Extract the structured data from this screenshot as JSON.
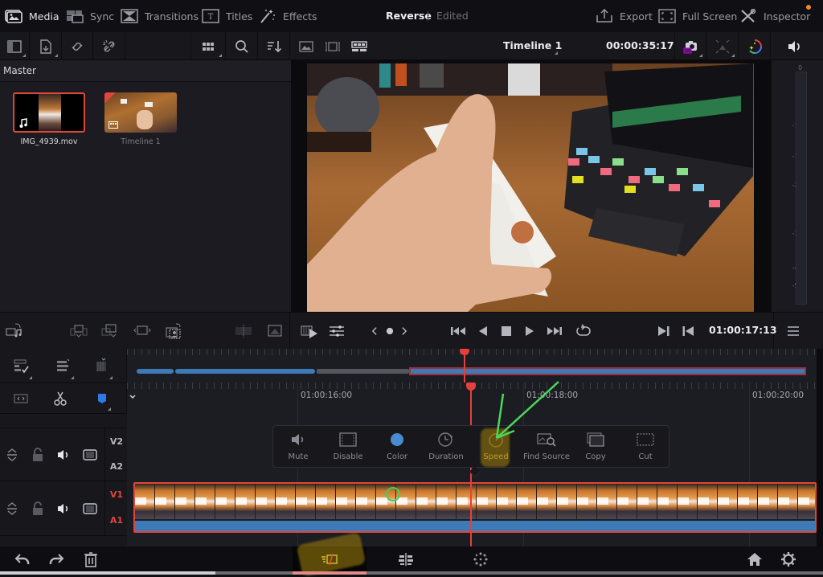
{
  "top_nav": {
    "items": [
      {
        "label": "Media",
        "icon": "media-icon",
        "active": true
      },
      {
        "label": "Sync",
        "icon": "sync-icon",
        "active": false
      },
      {
        "label": "Transitions",
        "icon": "transitions-icon",
        "active": false
      },
      {
        "label": "Titles",
        "icon": "titles-icon",
        "active": false
      },
      {
        "label": "Effects",
        "icon": "effects-wand-icon",
        "active": false
      }
    ],
    "project_title": "Reverse",
    "project_status": "Edited",
    "right_items": [
      {
        "label": "Export",
        "icon": "export-icon"
      },
      {
        "label": "Full Screen",
        "icon": "fullscreen-icon"
      },
      {
        "label": "Inspector",
        "icon": "inspector-tools-icon"
      }
    ],
    "inspector_badge_color": "#f08a24"
  },
  "toolbar": {
    "timeline_name": "Timeline 1",
    "source_timecode": "00:00:35:17",
    "icons": [
      "panel-toggle-icon",
      "import-media-icon",
      "relink-icon",
      "unlink-icon",
      "grid-view-icon",
      "search-icon",
      "sort-icon",
      "thumbnail-view-icon",
      "filmstrip-view-icon",
      "strip-view-icon",
      "snapshot-icon",
      "transform-icon",
      "color-wheel-icon",
      "volume-icon"
    ]
  },
  "media_pool": {
    "bin": "Master",
    "clips": [
      {
        "name": "IMG_4939.mov",
        "type": "video-with-audio",
        "selected": true
      },
      {
        "name": "Timeline 1",
        "type": "timeline",
        "selected": false
      }
    ]
  },
  "audio_meter": {
    "scale": [
      "0",
      "-5",
      "-10",
      "-15",
      "-20",
      "-30",
      "-40",
      "-50"
    ]
  },
  "transport": {
    "timecode": "01:00:17:13",
    "buttons": [
      "jump-start",
      "reverse-play",
      "stop",
      "play",
      "jump-end",
      "loop",
      "mark-out",
      "mark-in",
      "menu"
    ]
  },
  "timeline": {
    "ruler_labels": [
      "01:00:16:00",
      "01:00:18:00",
      "01:00:20:00"
    ],
    "tracks": [
      {
        "video": "V2",
        "audio": "A2",
        "active": false
      },
      {
        "video": "V1",
        "audio": "A1",
        "active": true
      }
    ],
    "accent_color": "#e0463c",
    "audio_color": "#3e7ab5"
  },
  "context_menu": {
    "items": [
      {
        "label": "Mute",
        "icon": "speaker-icon"
      },
      {
        "label": "Disable",
        "icon": "disable-clip-icon"
      },
      {
        "label": "Color",
        "icon": "color-dot-icon"
      },
      {
        "label": "Duration",
        "icon": "duration-clock-icon"
      },
      {
        "label": "Speed",
        "icon": "speed-gauge-icon",
        "highlighted": true
      },
      {
        "label": "Find Source",
        "icon": "find-source-icon"
      },
      {
        "label": "Copy",
        "icon": "copy-icon"
      },
      {
        "label": "Cut",
        "icon": "cut-icon"
      }
    ]
  },
  "bottom_bar": {
    "icons": [
      "undo-icon",
      "redo-icon",
      "trash-icon",
      "cut-page-icon",
      "edit-page-icon",
      "fairlight-dots-icon",
      "home-icon",
      "settings-gear-icon"
    ]
  }
}
